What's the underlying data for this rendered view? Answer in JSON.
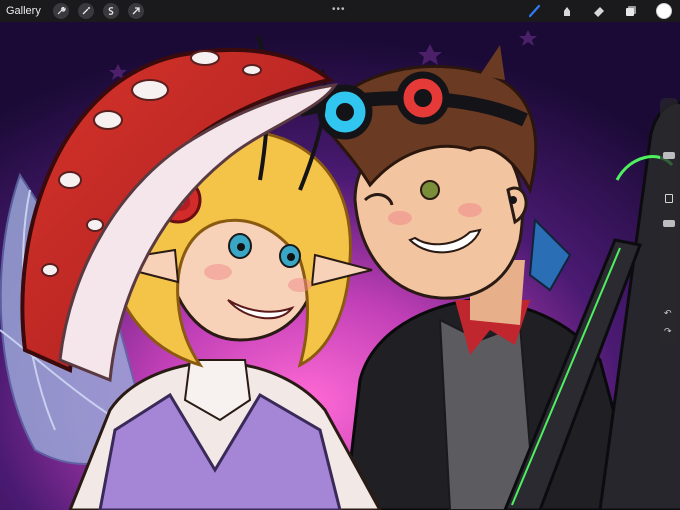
{
  "toolbar": {
    "gallery_label": "Gallery",
    "left_tools": [
      "wrench-icon",
      "magic-wand-icon",
      "selection-icon",
      "transform-arrow-icon"
    ],
    "center_grip": "•••",
    "right_tools": [
      "brush-icon",
      "smudge-icon",
      "eraser-icon",
      "layers-icon"
    ],
    "active_tool": "brush-icon",
    "current_color": "#ffffff",
    "accent_color": "#2f7cf6"
  },
  "sidebar": {
    "controls": [
      "brush-size-slider",
      "modify-button",
      "opacity-slider",
      "undo-button",
      "redo-button"
    ]
  },
  "canvas": {
    "content": "artwork-illustration"
  }
}
